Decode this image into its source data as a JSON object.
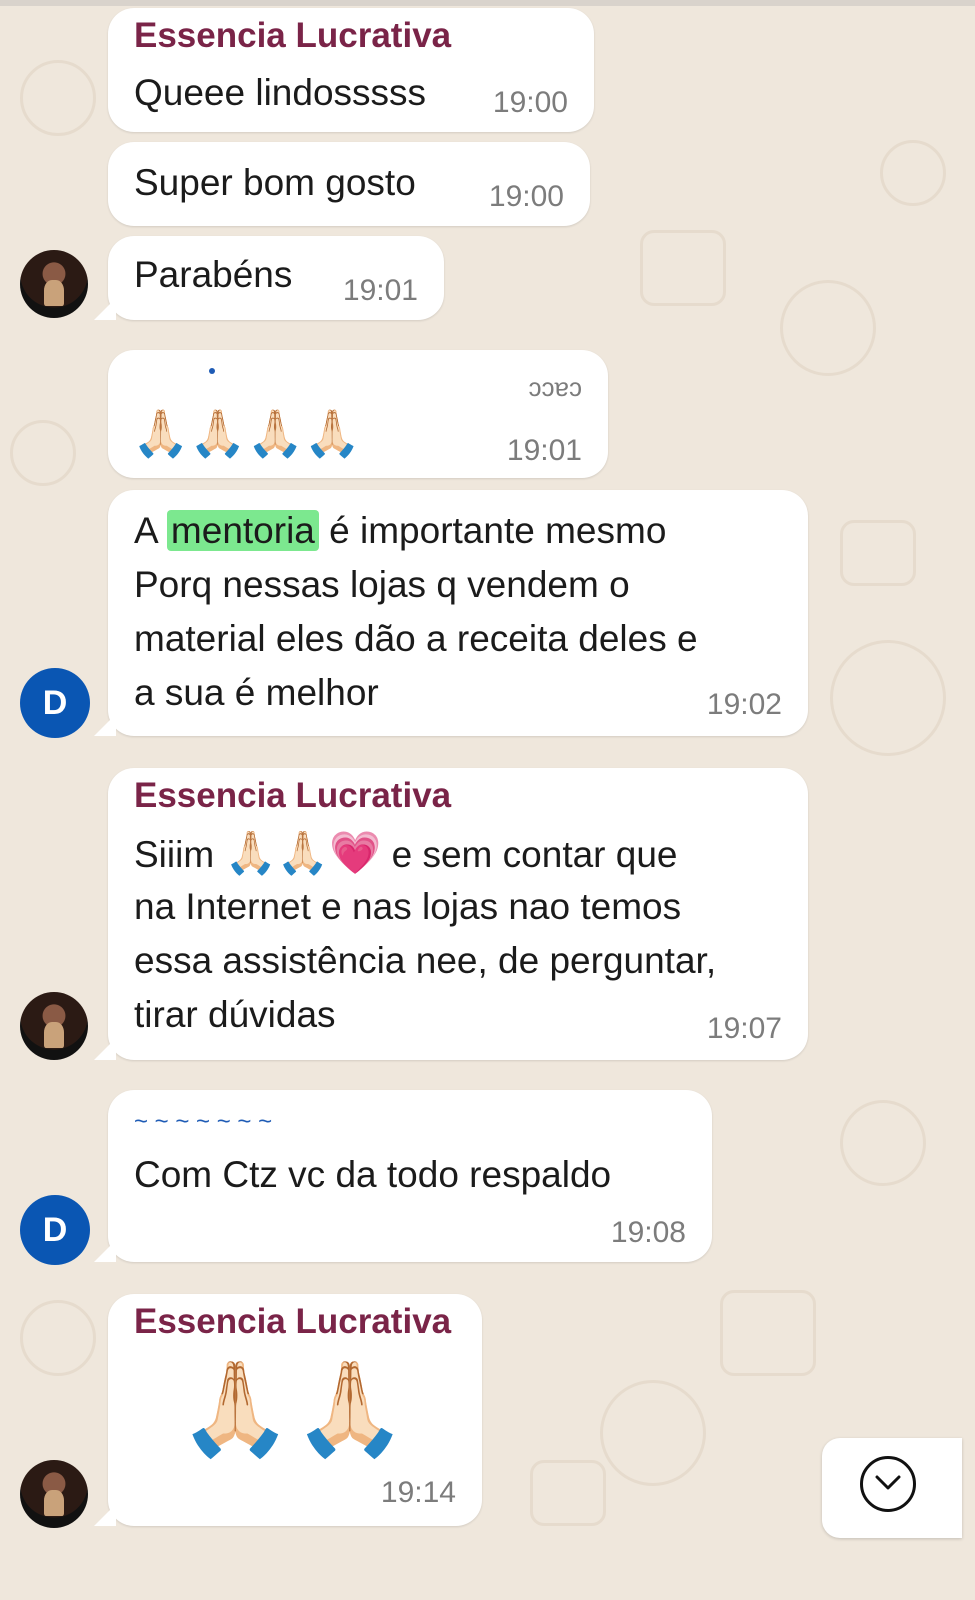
{
  "colors": {
    "background": "#efe7dc",
    "bubble": "#ffffff",
    "sender": "#7a2448",
    "avatar_blue": "#0a56b3",
    "highlight": "#7ce88f"
  },
  "messages": [
    {
      "sender": "Essencia Lucrativa",
      "text": "Queee lindosssss",
      "time": "19:00"
    },
    {
      "text": "Super bom gosto",
      "time": "19:00"
    },
    {
      "text": "Parabéns",
      "time": "19:01",
      "avatar": "profile-photo"
    },
    {
      "partial_text": "ɔɔɐɔ",
      "text": "🙏🏻🙏🏻🙏🏻🙏🏻",
      "time": "19:01"
    },
    {
      "avatar": "D",
      "lines": [
        "A",
        "mentoria",
        "é importante mesmo",
        "Porq nessas lojas q vendem o",
        "material eles dão a receita deles e",
        "a sua é melhor"
      ],
      "time": "19:02"
    },
    {
      "sender": "Essencia Lucrativa",
      "avatar": "profile-photo",
      "lines": [
        "Siiim",
        "🙏🏻🙏🏻💗",
        "e sem contar que",
        "na Internet e nas lojas nao temos",
        "essa assistência nee, de perguntar,",
        "tirar dúvidas"
      ],
      "time": "19:07"
    },
    {
      "avatar": "D",
      "partial_text": "~ ~ ~ ~ ~ ~ ~",
      "text": "Com Ctz vc da todo respaldo",
      "time": "19:08"
    },
    {
      "sender": "Essencia Lucrativa",
      "avatar": "profile-photo",
      "text": "🙏🏻🙏🏻",
      "time": "19:14"
    }
  ],
  "scroll_button": {
    "icon": "chevron-down-icon"
  }
}
